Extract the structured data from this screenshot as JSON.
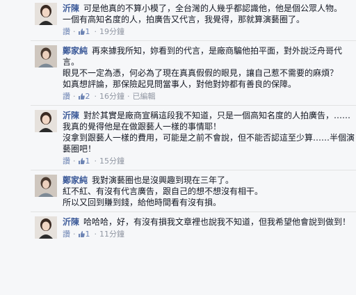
{
  "comments": [
    {
      "author": "沂陳",
      "text": "可是他真的不算小模了，全台灣的人幾乎都認識他，他是個公眾人物。\n一個有高知名度的人，拍廣告又代言，我覺得，那就算演藝圈了。",
      "like": "讚",
      "likes": "1",
      "time": "19分鐘",
      "edited": ""
    },
    {
      "author": "鄭家純",
      "text": "再來據我所知，妳看到的代言，是廠商騙他拍平面，對外說泛舟哥代言。\n眼見不一定為憑，何必為了現在真真假假的眼見，讓自己惹不需要的麻煩？\n如真想評論，那保險起見問當事人，對他對妳都有善良的保障。",
      "like": "讚",
      "likes": "2",
      "time": "16分鐘",
      "edited": "已編輯"
    },
    {
      "author": "沂陳",
      "text": "對於其實是廠商宣稱這段我不知道，只是一個高知名度的人拍廣告，……我真的覺得他是在做跟藝人一樣的事情耶！\n沒拿到跟藝人一樣的費用，可能是之前不會說，但不能否認這至少算……半個演藝圈吧！",
      "like": "讚",
      "likes": "1",
      "time": "15分鐘",
      "edited": ""
    },
    {
      "author": "鄭家純",
      "text": "我對演藝圈也是沒興趣到現在三年了。\n紅不紅、有沒有代言廣告，跟自己的想不想沒有相干。\n所以又回到賺到錢，給他時間看有沒有損。",
      "like": "",
      "likes": "",
      "time": "",
      "edited": ""
    },
    {
      "author": "沂陳",
      "text": "哈哈哈，好，有沒有損我文章裡也說我不知道，但我希望他會說到做到！",
      "like": "讚",
      "likes": "1",
      "time": "11分鐘",
      "edited": ""
    }
  ],
  "meta": {
    "separator": "·"
  },
  "colors": {
    "author": "#3b5998",
    "meta": "#9197a3",
    "link": "#6d84b4"
  }
}
